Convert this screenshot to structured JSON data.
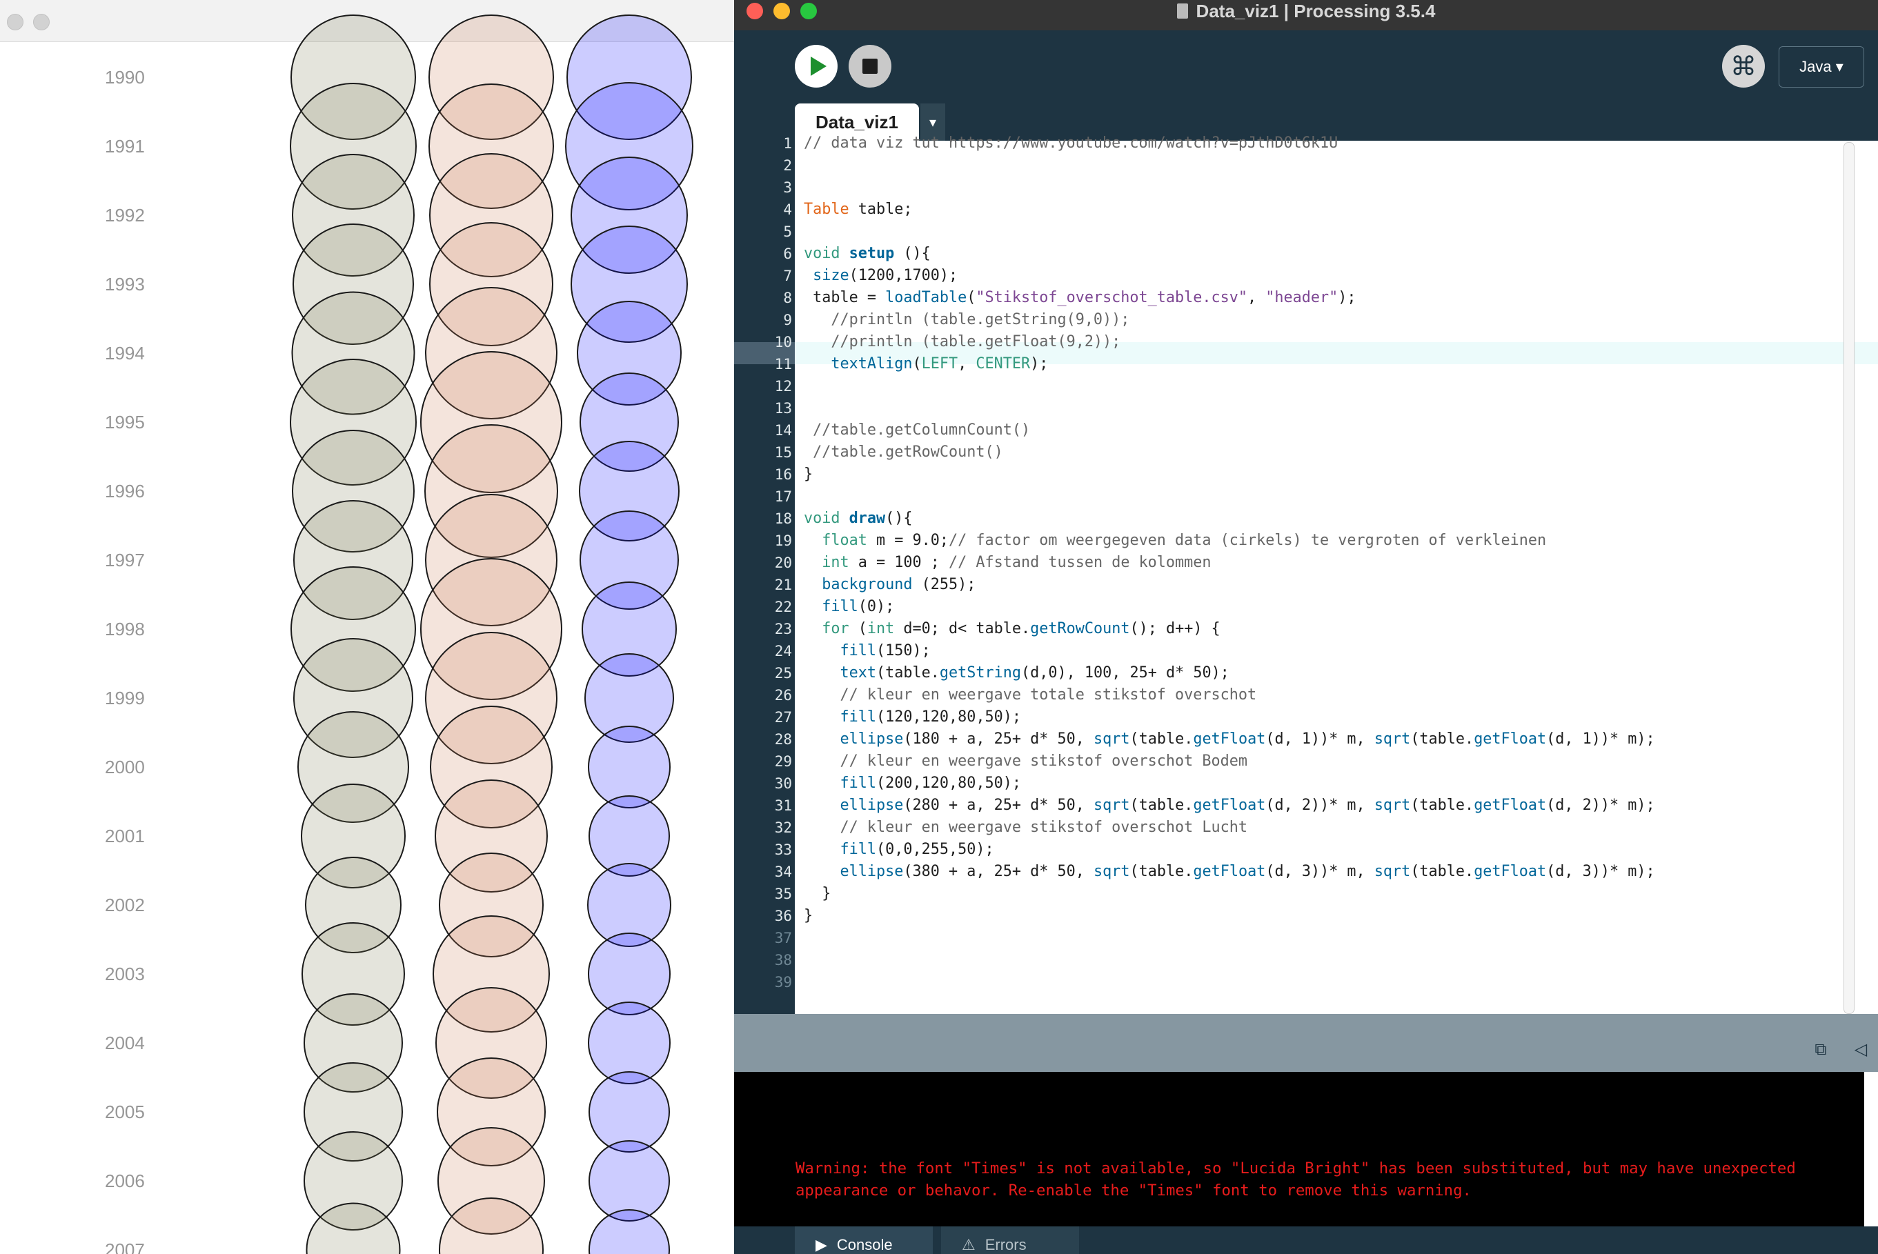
{
  "sketch": {
    "years": [
      "1990",
      "1991",
      "1992",
      "1993",
      "1994",
      "1995",
      "1996",
      "1997",
      "1998",
      "1999",
      "2000",
      "2001",
      "2002",
      "2003",
      "2004",
      "2005",
      "2006",
      "2007"
    ],
    "circle_colors": {
      "totaal": "#b4b49e",
      "bodem": "#dc9a80",
      "lucht": "#8080ff"
    },
    "diameters": {
      "totaal": [
        180,
        182,
        176,
        174,
        177,
        182,
        176,
        172,
        180,
        172,
        160,
        150,
        138,
        148,
        142,
        142,
        142,
        135
      ],
      "bodem": [
        180,
        180,
        178,
        178,
        190,
        204,
        192,
        190,
        204,
        190,
        176,
        162,
        150,
        168,
        160,
        156,
        154,
        150
      ],
      "lucht": [
        180,
        184,
        168,
        168,
        150,
        142,
        144,
        142,
        136,
        128,
        118,
        116,
        120,
        118,
        118,
        116,
        116,
        116
      ]
    }
  },
  "ide": {
    "window_title": "Data_viz1 | Processing 3.5.4",
    "mode": "Java ▾",
    "debug_icon": "⌘",
    "tab_name": "Data_viz1",
    "tab_menu": "▾",
    "console_tab": "Console",
    "errors_tab": "Errors",
    "console_message": "Warning: the font \"Times\" is not available, so \"Lucida Bright\" has been substituted, but may have unexpected\nappearance or behavor. Re-enable the \"Times\" font to remove this warning.",
    "line_numbers": [
      "1",
      "2",
      "3",
      "4",
      "5",
      "6",
      "7",
      "8",
      "9",
      "10",
      "11",
      "12",
      "13",
      "14",
      "15",
      "16",
      "17",
      "18",
      "19",
      "20",
      "21",
      "22",
      "23",
      "24",
      "25",
      "26",
      "27",
      "28",
      "29",
      "30",
      "31",
      "32",
      "33",
      "34",
      "35",
      "36",
      "37",
      "38",
      "39"
    ],
    "code_lines": [
      "// data viz tut https://www.youtube.com/watch?v=pJthD0t6k1U",
      "",
      "",
      "Table table;",
      "",
      "void setup (){",
      " size(1200,1700);",
      " table = loadTable(\"Stikstof_overschot_table.csv\", \"header\");",
      "   //println (table.getString(9,0));",
      "   //println (table.getFloat(9,2));",
      "   textAlign(LEFT, CENTER);",
      "",
      "",
      " //table.getColumnCount()",
      " //table.getRowCount()",
      "}",
      "",
      "void draw(){",
      "  float m = 9.0;// factor om weergegeven data (cirkels) te vergroten of verkleinen",
      "  int a = 100 ; // Afstand tussen de kolommen",
      "  background (255);",
      "  fill(0);",
      "  for (int d=0; d< table.getRowCount(); d++) {",
      "    fill(150);",
      "    text(table.getString(d,0), 100, 25+ d* 50);",
      "    // kleur en weergave totale stikstof overschot",
      "    fill(120,120,80,50);",
      "    ellipse(180 + a, 25+ d* 50, sqrt(table.getFloat(d, 1))* m, sqrt(table.getFloat(d, 1))* m);",
      "    // kleur en weergave stikstof overschot Bodem",
      "    fill(200,120,80,50);",
      "    ellipse(280 + a, 25+ d* 50, sqrt(table.getFloat(d, 2))* m, sqrt(table.getFloat(d, 2))* m);",
      "    // kleur en weergave stikstof overschot Lucht",
      "    fill(0,0,255,50);",
      "    ellipse(380 + a, 25+ d* 50, sqrt(table.getFloat(d, 3))* m, sqrt(table.getFloat(d, 3))* m);",
      "  }",
      "}",
      "",
      "",
      ""
    ]
  }
}
